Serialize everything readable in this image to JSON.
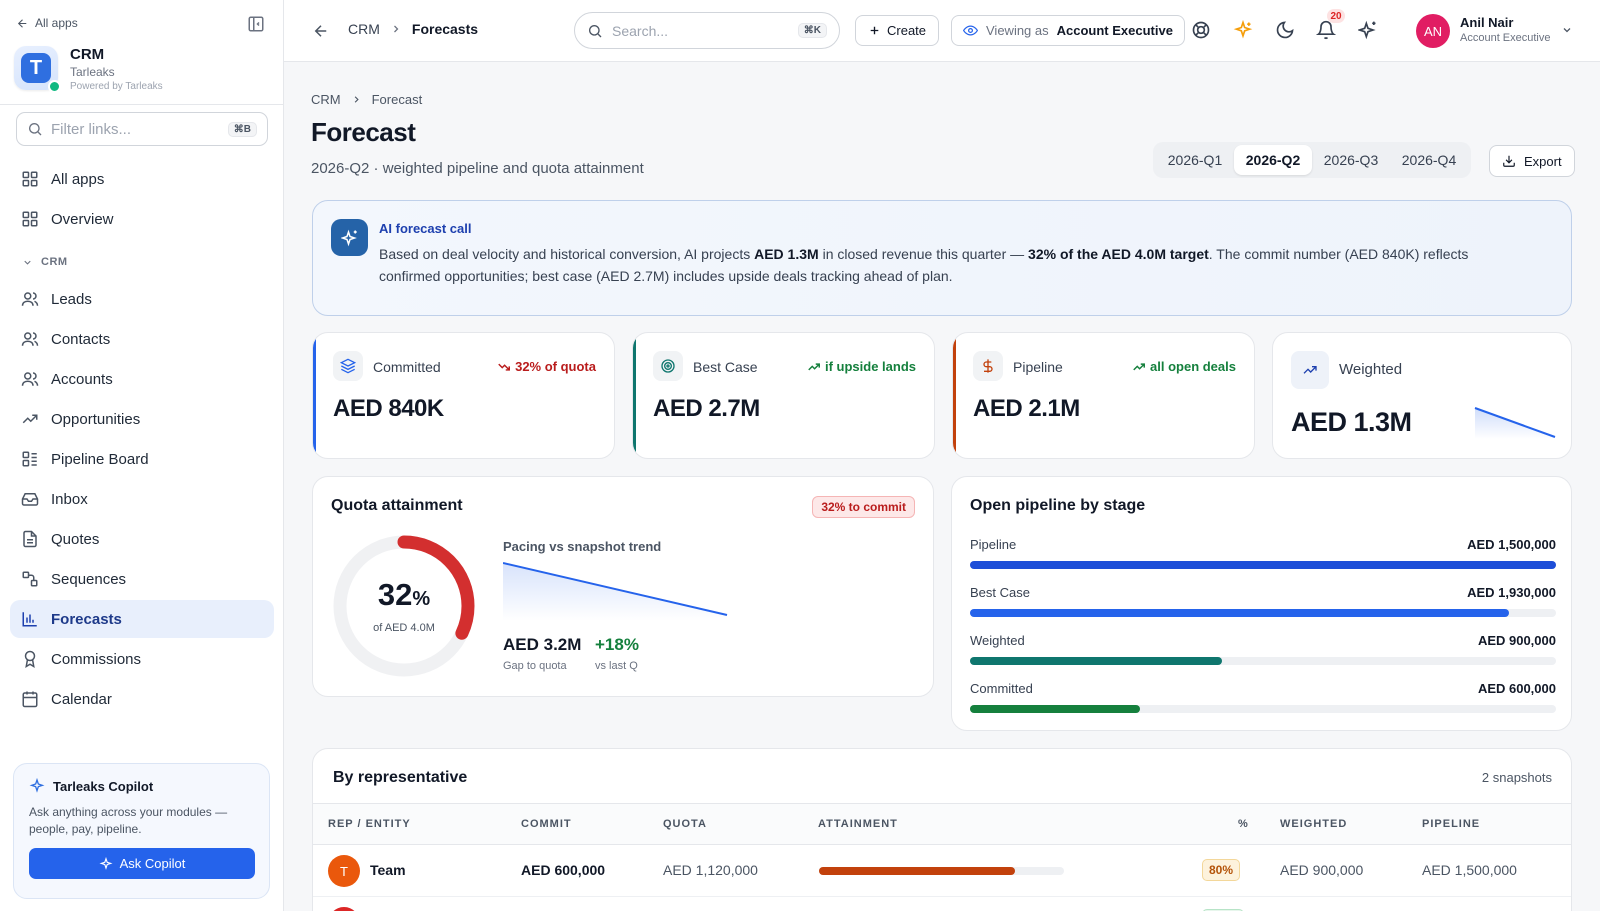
{
  "sidebar": {
    "back_label": "All apps",
    "app_name": "CRM",
    "org": "Tarleaks",
    "powered": "Powered by Tarleaks",
    "logo_letter": "T",
    "filter_placeholder": "Filter links...",
    "filter_kbd": "⌘B",
    "top_items": [
      {
        "label": "All apps",
        "icon": "grid-icon"
      },
      {
        "label": "Overview",
        "icon": "grid-icon"
      }
    ],
    "section": "CRM",
    "items": [
      {
        "label": "Leads",
        "icon": "users-icon"
      },
      {
        "label": "Contacts",
        "icon": "users-icon"
      },
      {
        "label": "Accounts",
        "icon": "users-icon"
      },
      {
        "label": "Opportunities",
        "icon": "trend-icon"
      },
      {
        "label": "Pipeline Board",
        "icon": "board-icon"
      },
      {
        "label": "Inbox",
        "icon": "inbox-icon"
      },
      {
        "label": "Quotes",
        "icon": "file-icon"
      },
      {
        "label": "Sequences",
        "icon": "sequence-icon"
      },
      {
        "label": "Forecasts",
        "icon": "bar-chart-icon",
        "active": true
      },
      {
        "label": "Commissions",
        "icon": "award-icon"
      },
      {
        "label": "Calendar",
        "icon": "calendar-icon"
      }
    ],
    "copilot": {
      "title": "Tarleaks Copilot",
      "desc": "Ask anything across your modules — people, pay, pipeline.",
      "button": "Ask Copilot"
    }
  },
  "topbar": {
    "crumb_root": "CRM",
    "crumb_current": "Forecasts",
    "search_placeholder": "Search...",
    "search_kbd": "⌘K",
    "create_label": "Create",
    "viewing_prefix": "Viewing as",
    "viewing_role": "Account Executive",
    "notif_count": "20",
    "user_initials": "AN",
    "user_name": "Anil Nair",
    "user_role": "Account Executive"
  },
  "page": {
    "crumb_root": "CRM",
    "crumb_current": "Forecast",
    "title": "Forecast",
    "subtitle": "2026-Q2 · weighted pipeline and quota attainment",
    "quarters": [
      "2026-Q1",
      "2026-Q2",
      "2026-Q3",
      "2026-Q4"
    ],
    "active_quarter": "2026-Q2",
    "export_label": "Export"
  },
  "ai": {
    "title": "AI forecast call",
    "t1": "Based on deal velocity and historical conversion, AI projects ",
    "b1": "AED 1.3M",
    "t2": " in closed revenue this quarter — ",
    "b2": "32% of the AED 4.0M target",
    "t3": ". The commit number (AED 840K) reflects confirmed opportunities; best case (AED 2.7M) includes upside deals tracking ahead of plan."
  },
  "kpis": [
    {
      "label": "Committed",
      "value": "AED 840K",
      "trend": "32% of quota",
      "trend_color": "#b91c1c",
      "accent": "#2563eb",
      "icon": "layers-icon"
    },
    {
      "label": "Best Case",
      "value": "AED 2.7M",
      "trend": "if upside lands",
      "trend_color": "#15803d",
      "accent": "#0f766e",
      "icon": "target-icon"
    },
    {
      "label": "Pipeline",
      "value": "AED 2.1M",
      "trend": "all open deals",
      "trend_color": "#15803d",
      "accent": "#c2410c",
      "icon": "dollar-icon"
    },
    {
      "label": "Weighted",
      "value": "AED 1.3M",
      "trend": "",
      "accent": "",
      "icon": "trend-up-icon"
    }
  ],
  "quota": {
    "title": "Quota attainment",
    "chip": "32% to commit",
    "percent_num": "32",
    "percent_sign": "%",
    "percent": 32,
    "of_label": "of AED 4.0M",
    "trend_title": "Pacing vs snapshot trend",
    "gap_value": "AED 3.2M",
    "gap_label": "Gap to quota",
    "delta_value": "+18%",
    "delta_label": "vs last Q"
  },
  "stages": {
    "title": "Open pipeline by stage",
    "rows": [
      {
        "label": "Pipeline",
        "value": "AED 1,500,000",
        "fraction": 1.0,
        "color": "#1d4ed8"
      },
      {
        "label": "Best Case",
        "value": "AED 1,930,000",
        "fraction": 0.92,
        "color": "#2563eb"
      },
      {
        "label": "Weighted",
        "value": "AED 900,000",
        "fraction": 0.43,
        "color": "#0f766e"
      },
      {
        "label": "Committed",
        "value": "AED 600,000",
        "fraction": 0.29,
        "color": "#15803d"
      }
    ]
  },
  "reps": {
    "title": "By representative",
    "snapshots": "2 snapshots",
    "columns": [
      "REP / ENTITY",
      "COMMIT",
      "QUOTA",
      "ATTAINMENT",
      "%",
      "WEIGHTED",
      "PIPELINE"
    ],
    "rows": [
      {
        "initial": "T",
        "name": "Team",
        "commit": "AED 600,000",
        "quota": "AED 1,120,000",
        "attainment": 0.8,
        "pct": "80%",
        "weighted": "AED 900,000",
        "pipeline": "AED 1,500,000"
      }
    ]
  }
}
